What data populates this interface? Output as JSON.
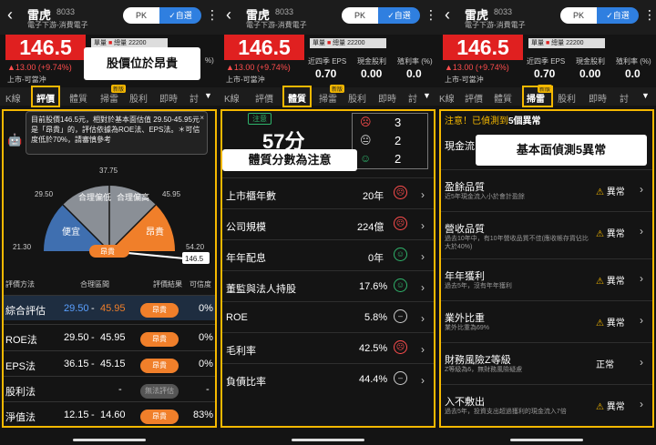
{
  "stock": {
    "name": "雷虎",
    "code": "8033",
    "industry": "電子下游-消費電子",
    "pk": "PK",
    "favorite": "✓自選",
    "price": "146.5",
    "change": "▲13.00 (+9.74%)",
    "limit": "上市-可當沖",
    "volume_prefix": "單量",
    "volume": "總量 22200",
    "eps_label": "近四季 EPS",
    "eps_value": "0.70",
    "dividend_label": "現金股利",
    "dividend_value": "0.00",
    "yield_label": "殖利率 (%)",
    "yield_value": "0.0",
    "tiny_cut": "%)"
  },
  "tabs": [
    "K線",
    "評價",
    "體質",
    "掃雷",
    "股利",
    "即時",
    "討"
  ],
  "tab_badge": "新版",
  "panel1": {
    "callout": "股價位於昂貴",
    "note": "目前股價146.5元，相對於基本面估值 29.50-45.95元是「昂貴」的，評估依據為ROE法、EPS法。＊可信度低於70%，請審慎參考",
    "note_close": "×",
    "gauge": {
      "labels": [
        "便宜",
        "合理偏低",
        "合理偏高",
        "昂貴"
      ],
      "ticks": [
        "21.30",
        "29.50",
        "37.75",
        "45.95",
        "54.20"
      ],
      "marker": "昂貴",
      "price_tag": "146.5"
    },
    "table_headers": [
      "評價方法",
      "合理區間",
      "評價結果",
      "可信度"
    ],
    "rows": [
      {
        "method": "綜合評估",
        "low": "29.50",
        "sep": " - ",
        "high": "45.95",
        "result": "昂貴",
        "conf": "0%"
      },
      {
        "method": "ROE法",
        "low": "29.50",
        "sep": " - ",
        "high": "45.95",
        "result": "昂貴",
        "conf": "0%"
      },
      {
        "method": "EPS法",
        "low": "36.15",
        "sep": " - ",
        "high": "45.15",
        "result": "昂貴",
        "conf": "0%"
      },
      {
        "method": "股利法",
        "low": "",
        "sep": "-",
        "high": "",
        "result": "無法評估",
        "conf": "-"
      },
      {
        "method": "淨值法",
        "low": "12.15",
        "sep": " - ",
        "high": "14.60",
        "result": "昂貴",
        "conf": "83%"
      }
    ]
  },
  "panel2": {
    "notice": "注意",
    "score": "57分",
    "callout": "體質分數為注意",
    "counts": [
      {
        "face": "☹",
        "n": "3"
      },
      {
        "face": "😐",
        "n": "2"
      },
      {
        "face": "☺",
        "n": "2"
      }
    ],
    "rows": [
      {
        "label": "上市櫃年數",
        "value": "20年",
        "face": "bad"
      },
      {
        "label": "公司規模",
        "value": "224億",
        "face": "bad"
      },
      {
        "label": "年年配息",
        "value": "0年",
        "face": "good"
      },
      {
        "label": "董監與法人持股",
        "value": "17.6%",
        "face": "good"
      },
      {
        "label": "ROE",
        "value": "5.8%",
        "face": "neutral"
      },
      {
        "label": "毛利率",
        "value": "42.5%",
        "face": "bad"
      },
      {
        "label": "負債比率",
        "value": "44.4%",
        "face": "neutral"
      }
    ]
  },
  "panel3": {
    "header_prefix": "注意！已偵測到",
    "header_count": "5個異常",
    "callout": "基本面偵測5異常",
    "first_title": "現金流",
    "rows": [
      {
        "title": "盈餘品質",
        "desc": "近5年現金流入小於會計盈餘",
        "status": "異常",
        "warn": true
      },
      {
        "title": "營收品質",
        "desc": "過去10年中，有10年營收品質不佳(應收帳存貨佔比大於40%)",
        "status": "異常",
        "warn": true
      },
      {
        "title": "年年獲利",
        "desc": "過去5年，沒有年年獲利",
        "status": "異常",
        "warn": true
      },
      {
        "title": "業外比重",
        "desc": "業外比重為69%",
        "status": "異常",
        "warn": true
      },
      {
        "title": "財務風險Z等級",
        "desc": "Z等級為6，無財務風險疑慮",
        "status": "正常",
        "warn": false
      },
      {
        "title": "入不敷出",
        "desc": "過去5年，投資支出超過獲利的現金流入7倍",
        "status": "異常",
        "warn": true
      }
    ]
  },
  "colors": {
    "accent": "#f5b800",
    "up": "#e02020",
    "expensive": "#f07f2a",
    "cheap": "#3f6fb0"
  }
}
